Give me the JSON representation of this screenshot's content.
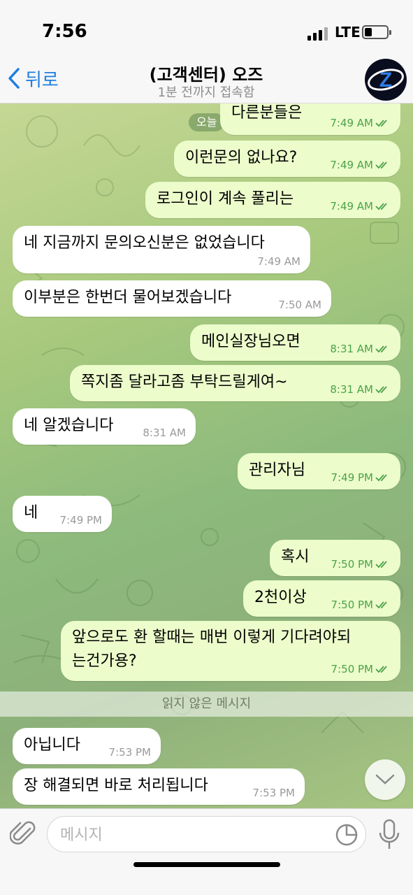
{
  "status": {
    "time": "7:56",
    "network": "LTE"
  },
  "header": {
    "back_label": "뒤로",
    "title": "(고객센터) 오즈",
    "subtitle": "1분 전까지 접속함",
    "avatar_letter": "Z"
  },
  "chat": {
    "date_chip": "오늘",
    "messages": [
      {
        "dir": "out",
        "text": "다른분들은",
        "time": "7:49 AM"
      },
      {
        "dir": "out",
        "text": "이런문의 없나요?",
        "time": "7:49 AM"
      },
      {
        "dir": "out",
        "text": "로그인이 계속 풀리는",
        "time": "7:49 AM"
      },
      {
        "dir": "in",
        "text": "네 지금까지 문의오신분은 없었습니다",
        "time": "7:49 AM"
      },
      {
        "dir": "in",
        "text": "이부분은 한번더 물어보겠습니다",
        "time": "7:50 AM"
      },
      {
        "dir": "out",
        "text": "메인실장님오면",
        "time": "8:31 AM"
      },
      {
        "dir": "out",
        "text": "쪽지좀 달라고좀 부탁드릴게여~",
        "time": "8:31 AM"
      },
      {
        "dir": "in",
        "text": "네 알겠습니다",
        "time": "8:31 AM"
      },
      {
        "dir": "out",
        "text": "관리자님",
        "time": "7:49 PM"
      },
      {
        "dir": "in",
        "text": "네",
        "time": "7:49 PM"
      },
      {
        "dir": "out",
        "text": "혹시",
        "time": "7:50 PM"
      },
      {
        "dir": "out",
        "text": "2천이상",
        "time": "7:50 PM"
      },
      {
        "dir": "out",
        "text_line1": "앞으로도 환 할때는 매번 이렇게 기다려야되",
        "text_line2": "는건가용?",
        "time": "7:50 PM"
      },
      {
        "dir": "in",
        "text": "아닙니다",
        "time": "7:53 PM"
      },
      {
        "dir": "in",
        "text": "장 해결되면 바로 처리됩니다",
        "time": "7:53 PM"
      }
    ],
    "unread_divider": "읽지 않은 메시지"
  },
  "composer": {
    "placeholder": "메시지",
    "value": ""
  },
  "icons": {
    "back": "chevron-left-icon",
    "attach": "paperclip-icon",
    "sticker": "sticker-icon",
    "mic": "microphone-icon",
    "scroll": "chevron-down-icon",
    "read": "double-check-icon"
  },
  "colors": {
    "accent": "#1f7ee0",
    "outgoing_bubble": "#ecfccb",
    "incoming_bubble": "#ffffff",
    "read_check": "#4aa34a"
  }
}
